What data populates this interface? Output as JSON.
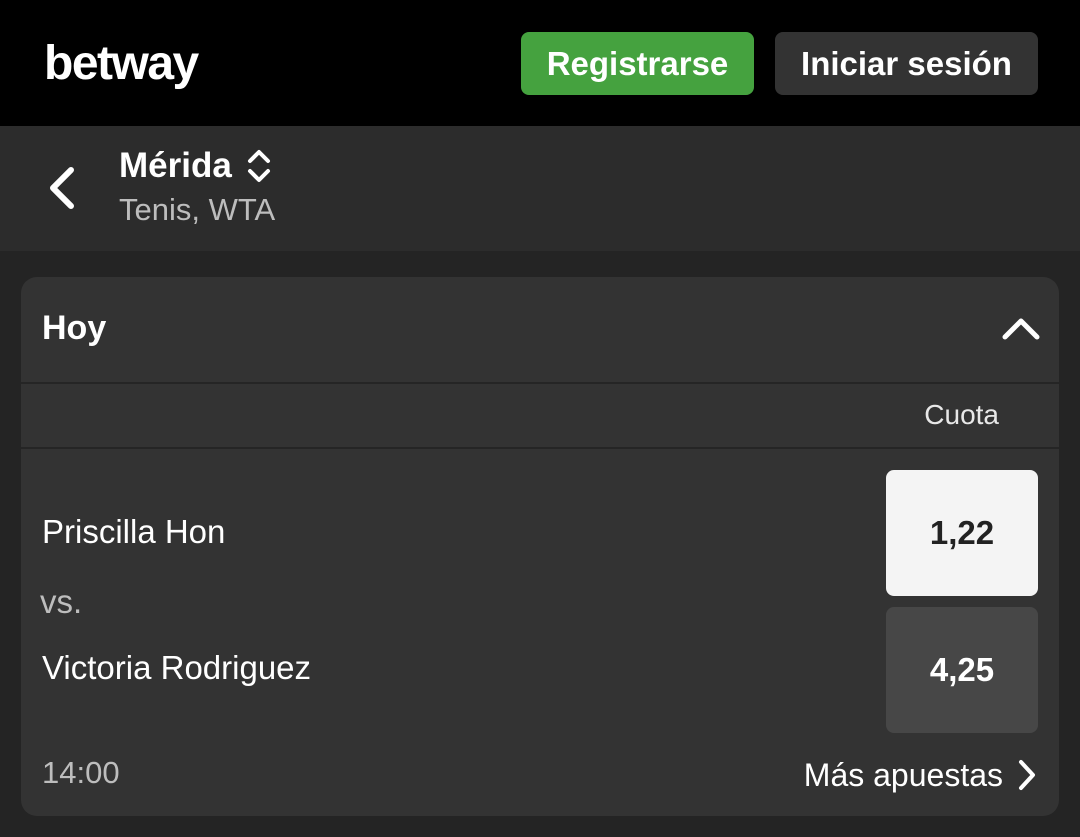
{
  "header": {
    "logo_text": "betway",
    "register_label": "Registrarse",
    "login_label": "Iniciar sesión",
    "accent_color": "#45a23f"
  },
  "event_nav": {
    "title": "Mérida",
    "subtitle": "Tenis, WTA",
    "back_icon": "chevron-left-icon",
    "switch_icon": "sort-updown-icon"
  },
  "section": {
    "title": "Hoy",
    "collapse_icon": "chevron-up-icon",
    "column_header": "Cuota",
    "matches": [
      {
        "player1": "Priscilla Hon",
        "vs_label": "vs.",
        "player2": "Victoria Rodriguez",
        "odds1": "1,22",
        "odds2": "4,25",
        "time": "14:00",
        "more_bets_label": "Más apuestas"
      }
    ]
  }
}
